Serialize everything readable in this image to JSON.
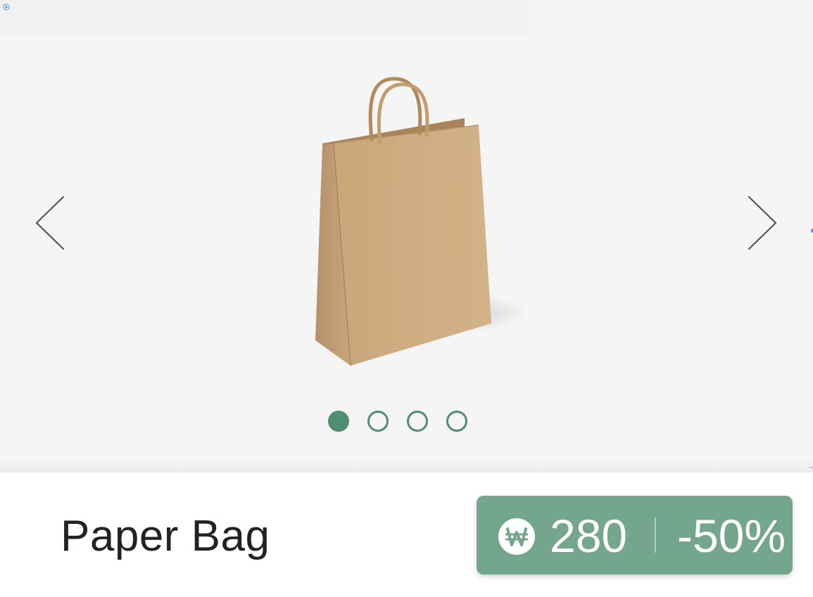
{
  "product": {
    "name": "Paper Bag",
    "image_icon": "paper-bag-image"
  },
  "carousel": {
    "prev_icon": "chevron-left-icon",
    "next_icon": "chevron-right-icon",
    "slide_count": 4,
    "active_index": 0
  },
  "price": {
    "currency_icon": "won-currency-icon",
    "amount": "280",
    "discount": "-50%"
  },
  "colors": {
    "accent": "#4f8e70",
    "badge": "#74a58d",
    "carousel_bg": "#f5f5f5",
    "title_text": "#222222"
  }
}
